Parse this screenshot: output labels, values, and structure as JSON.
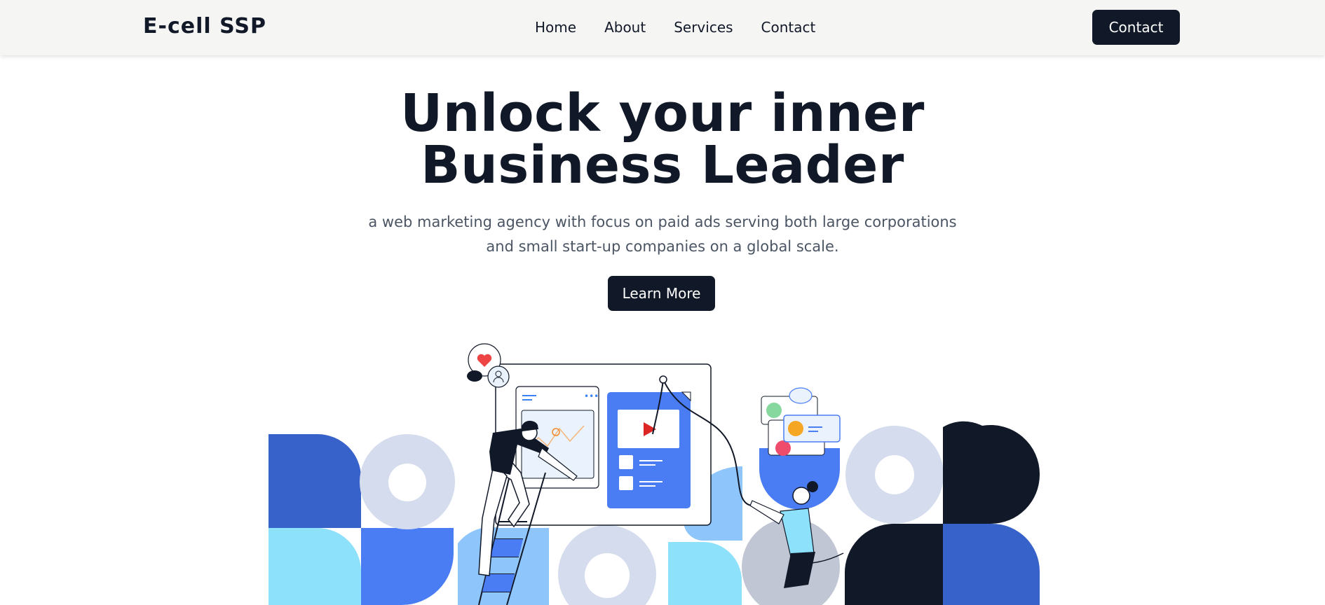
{
  "nav": {
    "logo": "E-cell SSP",
    "links": [
      "Home",
      "About",
      "Services",
      "Contact"
    ],
    "cta_label": "Contact"
  },
  "hero": {
    "title_line1": "Unlock your inner",
    "title_line2": "Business Leader",
    "subtitle": "a web marketing agency with focus on paid ads serving both large corporations and small start-up companies on a global scale.",
    "cta_label": "Learn More"
  },
  "colors": {
    "dark": "#111827",
    "blue": "#3b82f6",
    "royal": "#3762c9",
    "light_blue": "#8ec5fb",
    "cyan": "#8ee1fb",
    "pale": "#d4dced",
    "gray": "#c0c6d4",
    "nav_bg": "#f5f5f4"
  },
  "icons": [
    "heart-icon",
    "chat-icon",
    "user-icon",
    "play-icon",
    "more-icon"
  ]
}
